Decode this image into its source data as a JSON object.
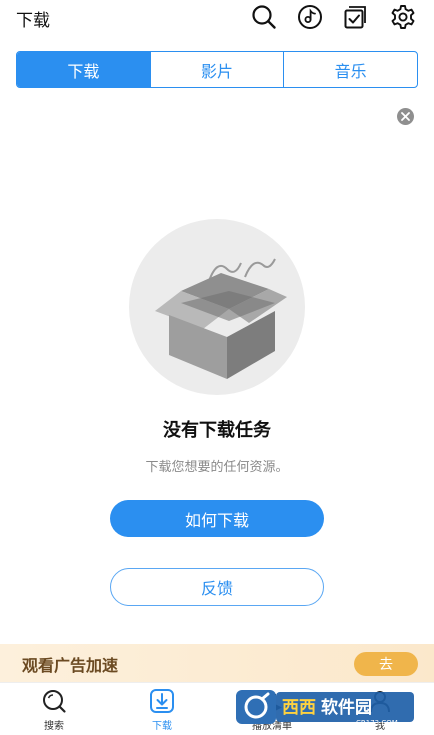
{
  "header": {
    "title": "下载",
    "icons": [
      "search-icon",
      "music-disc-icon",
      "checklist-icon",
      "settings-icon"
    ]
  },
  "tabs": [
    {
      "label": "下载",
      "active": true
    },
    {
      "label": "影片",
      "active": false
    },
    {
      "label": "音乐",
      "active": false
    }
  ],
  "empty_state": {
    "title": "没有下载任务",
    "subtitle": "下载您想要的任何资源。",
    "primary_button": "如何下载",
    "secondary_button": "反馈"
  },
  "ad_bar": {
    "text": "观看广告加速",
    "button": "去"
  },
  "bottom_nav": {
    "items": [
      {
        "label": "搜索",
        "icon": "search-icon",
        "active": false
      },
      {
        "label": "下载",
        "icon": "download-icon",
        "active": true
      },
      {
        "label": "播放清单",
        "icon": "playlist-icon",
        "active": false
      },
      {
        "label": "我",
        "icon": "profile-icon",
        "active": false
      }
    ]
  },
  "watermark": {
    "brand": "西西软件园",
    "url": "CR173.COM"
  },
  "colors": {
    "accent": "#2b8ff0",
    "ad_background": "#fdf0dc",
    "ad_button": "#f0b54b"
  }
}
